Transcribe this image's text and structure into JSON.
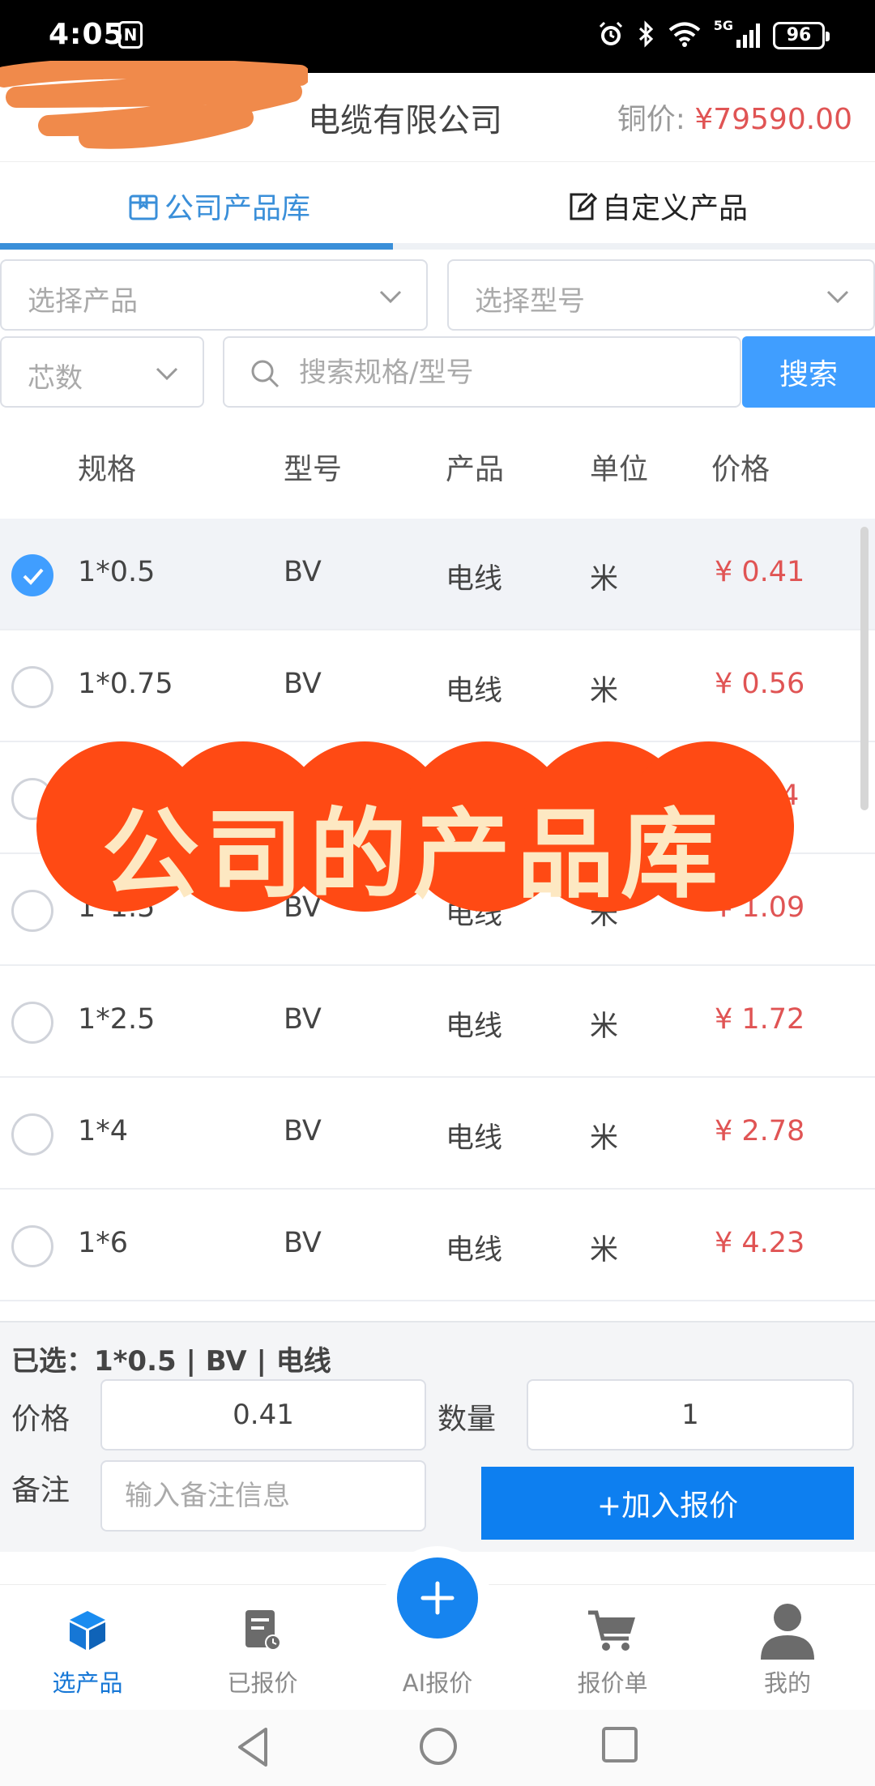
{
  "status_bar": {
    "time": "4:05",
    "nfc_glyph": "N",
    "network": "5G",
    "battery": "96",
    "icons": [
      "nfc-icon",
      "alarm-icon",
      "bluetooth-icon",
      "wifi-icon",
      "signal-icon",
      "battery-icon"
    ]
  },
  "header": {
    "company_name_visible": "电缆有限公司",
    "copper_price_label": "铜价: ",
    "copper_price_value": "¥79590.00"
  },
  "tabs": [
    {
      "label": "公司产品库",
      "icon": "box-icon",
      "active": true
    },
    {
      "label": "自定义产品",
      "icon": "edit-icon",
      "active": false
    }
  ],
  "filters": {
    "product_select_placeholder": "选择产品",
    "model_select_placeholder": "选择型号",
    "cores_select_placeholder": "芯数",
    "search_placeholder": "搜索规格/型号",
    "search_button": "搜索"
  },
  "table": {
    "columns": [
      "规格",
      "型号",
      "产品",
      "单位",
      "价格"
    ],
    "rows": [
      {
        "spec": "1*0.5",
        "model": "BV",
        "product": "电线",
        "unit": "米",
        "price": "¥ 0.41",
        "selected": true
      },
      {
        "spec": "1*0.75",
        "model": "BV",
        "product": "电线",
        "unit": "米",
        "price": "¥ 0.56",
        "selected": false
      },
      {
        "spec": "",
        "model": "",
        "product": "",
        "unit": "",
        "price": "4",
        "selected": false
      },
      {
        "spec": "1*1.5",
        "model": "BV",
        "product": "电线",
        "unit": "米",
        "price": "¥ 1.09",
        "selected": false
      },
      {
        "spec": "1*2.5",
        "model": "BV",
        "product": "电线",
        "unit": "米",
        "price": "¥ 1.72",
        "selected": false
      },
      {
        "spec": "1*4",
        "model": "BV",
        "product": "电线",
        "unit": "米",
        "price": "¥ 2.78",
        "selected": false
      },
      {
        "spec": "1*6",
        "model": "BV",
        "product": "电线",
        "unit": "米",
        "price": "¥ 4.23",
        "selected": false
      }
    ]
  },
  "overlay_banner": {
    "text": "公司的产品库"
  },
  "bottom_panel": {
    "selected_summary": "已选：1*0.5 | BV | 电线",
    "price_label": "价格",
    "price_value": "0.41",
    "quantity_label": "数量",
    "quantity_value": "1",
    "note_label": "备注",
    "note_placeholder": "输入备注信息",
    "add_quote_button": "+加入报价"
  },
  "bottom_nav": {
    "items": [
      {
        "label": "选产品",
        "icon": "cube-icon",
        "active": true
      },
      {
        "label": "已报价",
        "icon": "quote-document-icon",
        "active": false
      },
      {
        "label": "AI报价",
        "icon": "plus-icon",
        "active": false
      },
      {
        "label": "报价单",
        "icon": "cart-icon",
        "active": false
      },
      {
        "label": "我的",
        "icon": "user-icon",
        "active": false
      }
    ]
  },
  "colors": {
    "accent_blue": "#409eff",
    "price_red": "#e05454",
    "banner_orange": "#ff4a14",
    "nav_active": "#1677d6"
  }
}
